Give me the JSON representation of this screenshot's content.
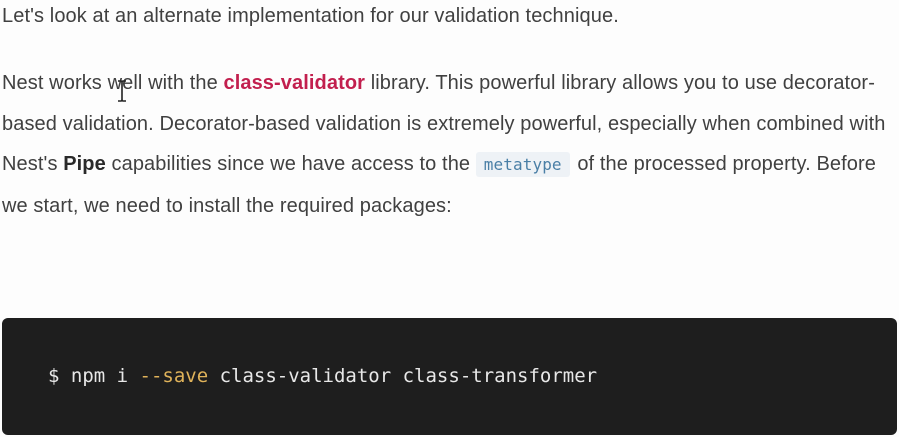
{
  "intro": {
    "text": "Let's look at an alternate implementation for our validation technique."
  },
  "paragraph": {
    "part1": "Nest works well with the ",
    "link_text": "class-validator",
    "part2": " library. This powerful library allows you to use decorator-based validation. Decorator-based validation is extremely powerful, especially when combined with Nest's ",
    "strong_text": "Pipe",
    "part3": " capabilities since we have access to the ",
    "inline_code": "metatype",
    "part4": " of the processed property. Before we start, we need to install the required packages:"
  },
  "code_block": {
    "prompt": "$ npm i ",
    "flag": "--save",
    "args": " class-validator class-transformer"
  },
  "colors": {
    "link": "#c21f4e",
    "code_background": "#1e1e1e",
    "code_flag": "#e0b35a",
    "inline_code_text": "#4a7fa6"
  },
  "icons": {
    "cursor": "text-cursor-icon"
  }
}
